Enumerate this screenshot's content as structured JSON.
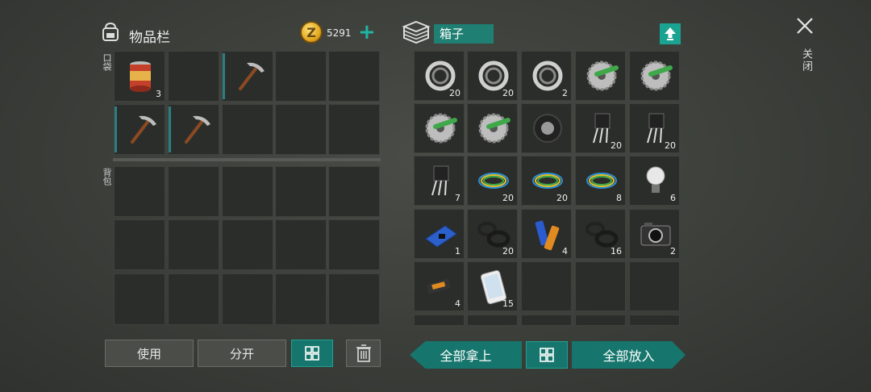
{
  "inventory": {
    "title": "物品栏",
    "coins": "5291",
    "plus_label": "+",
    "pocket_label": "口袋",
    "backpack_label": "背包",
    "pocket_slots": [
      {
        "icon": "canned-food-icon",
        "count": "3"
      },
      {
        "icon": "",
        "count": ""
      },
      {
        "icon": "pickaxe-icon",
        "count": ""
      },
      {
        "icon": "",
        "count": ""
      },
      {
        "icon": "",
        "count": ""
      },
      {
        "icon": "pickaxe-icon",
        "count": ""
      },
      {
        "icon": "pickaxe-icon",
        "count": ""
      },
      {
        "icon": "",
        "count": ""
      },
      {
        "icon": "",
        "count": ""
      },
      {
        "icon": "",
        "count": ""
      }
    ]
  },
  "container": {
    "name": "箱子",
    "slots": [
      {
        "icon": "bearing-icon",
        "count": "20"
      },
      {
        "icon": "bearing-icon",
        "count": "20"
      },
      {
        "icon": "bearing-icon",
        "count": "2"
      },
      {
        "icon": "saw-blade-icon",
        "count": ""
      },
      {
        "icon": "saw-blade-icon",
        "count": ""
      },
      {
        "icon": "saw-blade-icon",
        "count": ""
      },
      {
        "icon": "saw-blade-icon",
        "count": ""
      },
      {
        "icon": "tire-icon",
        "count": ""
      },
      {
        "icon": "transistor-icon",
        "count": "20"
      },
      {
        "icon": "transistor-icon",
        "count": "20"
      },
      {
        "icon": "transistor-icon",
        "count": "7"
      },
      {
        "icon": "wire-icon",
        "count": "20"
      },
      {
        "icon": "wire-icon",
        "count": "20"
      },
      {
        "icon": "wire-icon",
        "count": "8"
      },
      {
        "icon": "light-bulb-icon",
        "count": "6"
      },
      {
        "icon": "circuit-board-icon",
        "count": "1"
      },
      {
        "icon": "rubber-ring-icon",
        "count": "20"
      },
      {
        "icon": "battery-icon",
        "count": "4"
      },
      {
        "icon": "rubber-ring-icon",
        "count": "16"
      },
      {
        "icon": "camera-icon",
        "count": "2"
      },
      {
        "icon": "usb-drive-icon",
        "count": "4"
      },
      {
        "icon": "smartphone-icon",
        "count": "15"
      },
      {
        "icon": "",
        "count": ""
      },
      {
        "icon": "",
        "count": ""
      },
      {
        "icon": "",
        "count": ""
      }
    ]
  },
  "close": {
    "label": "关闭"
  },
  "buttons": {
    "use": "使用",
    "split": "分开",
    "take_all": "全部拿上",
    "put_all": "全部放入"
  }
}
